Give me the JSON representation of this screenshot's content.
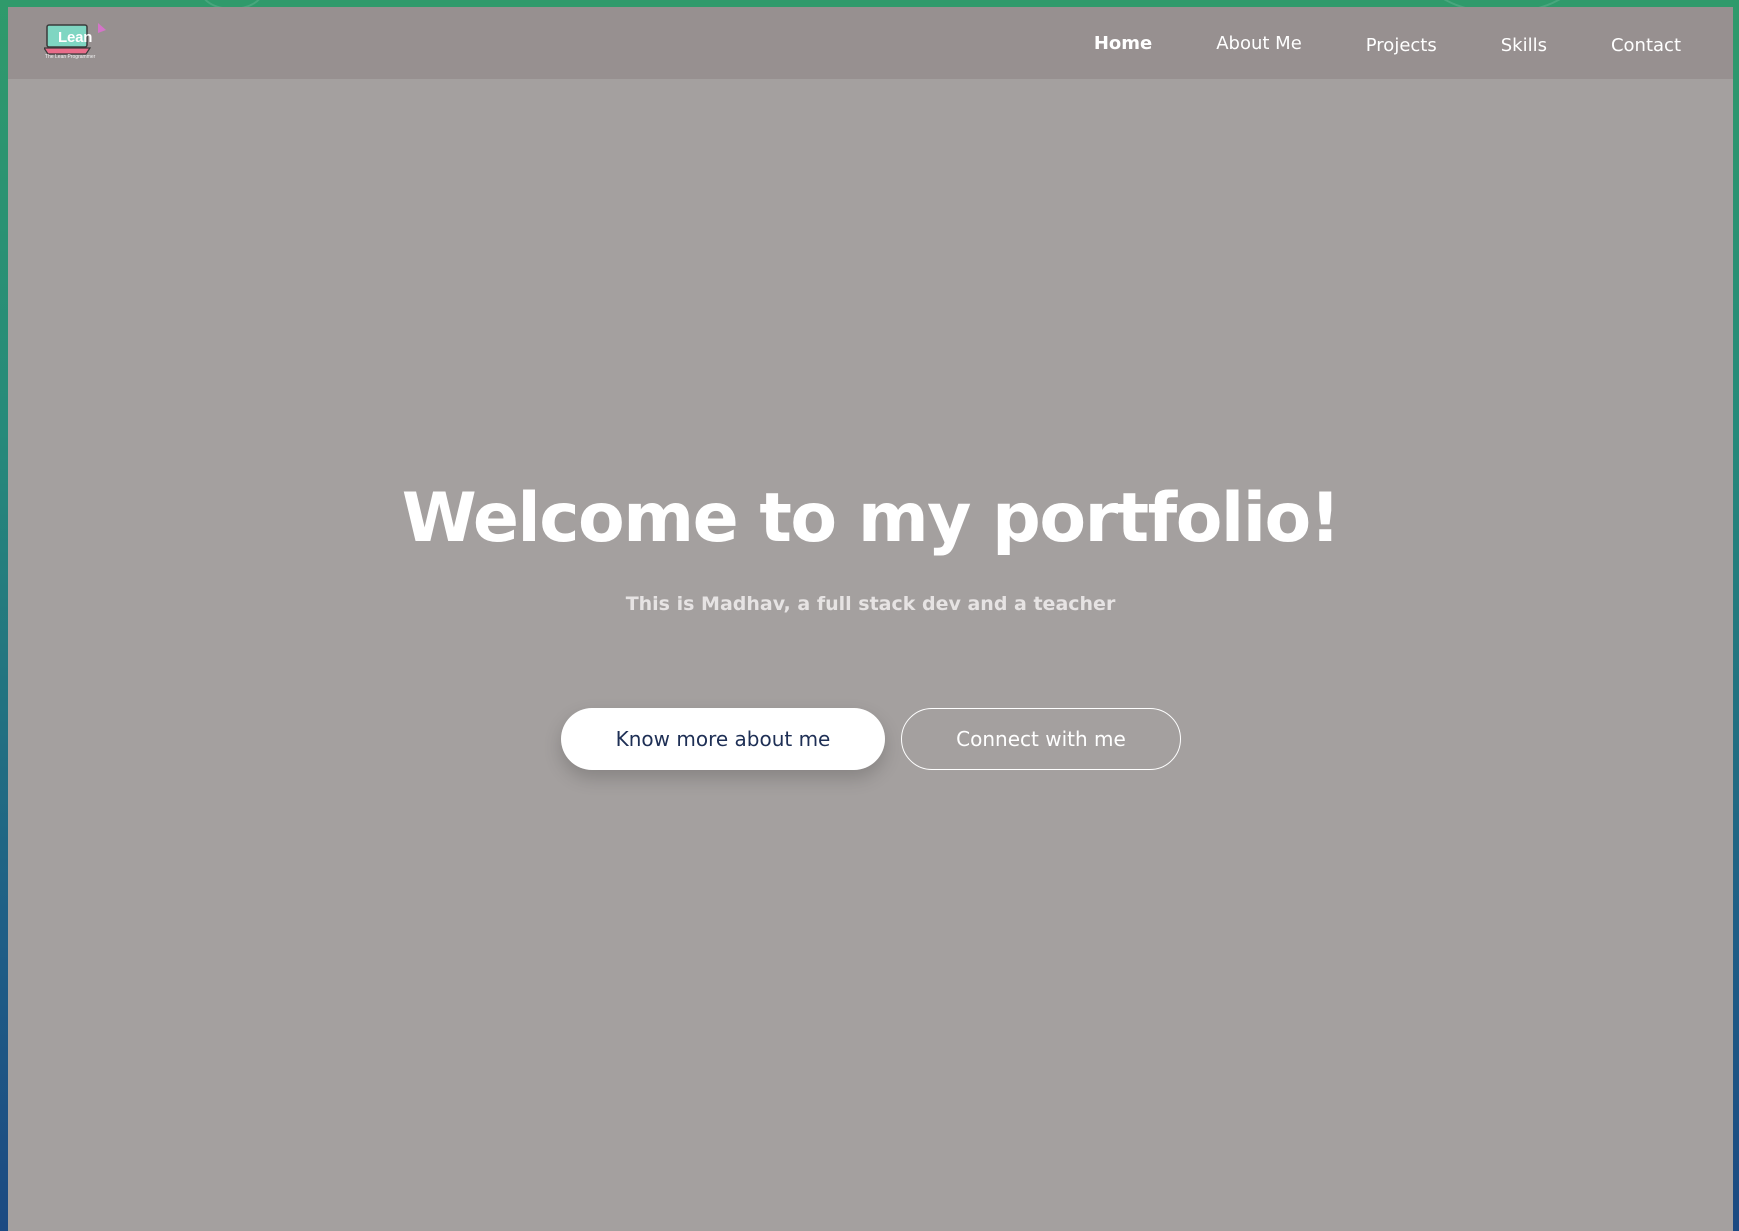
{
  "logo": {
    "name": "Lean",
    "tagline": "The Lean Programmer"
  },
  "nav": {
    "items": [
      {
        "label": "Home",
        "active": true
      },
      {
        "label": "About Me"
      },
      {
        "label": "Projects"
      },
      {
        "label": "Skills"
      },
      {
        "label": "Contact"
      }
    ]
  },
  "hero": {
    "title": "Welcome to my portfolio!",
    "subtitle": "This is Madhav, a full stack dev and a teacher",
    "primary_button": "Know more about me",
    "secondary_button": "Connect with me"
  },
  "colors": {
    "overlay": "#a4a09f",
    "navbar": "#979090",
    "primary_button_text": "#1e2f55"
  }
}
